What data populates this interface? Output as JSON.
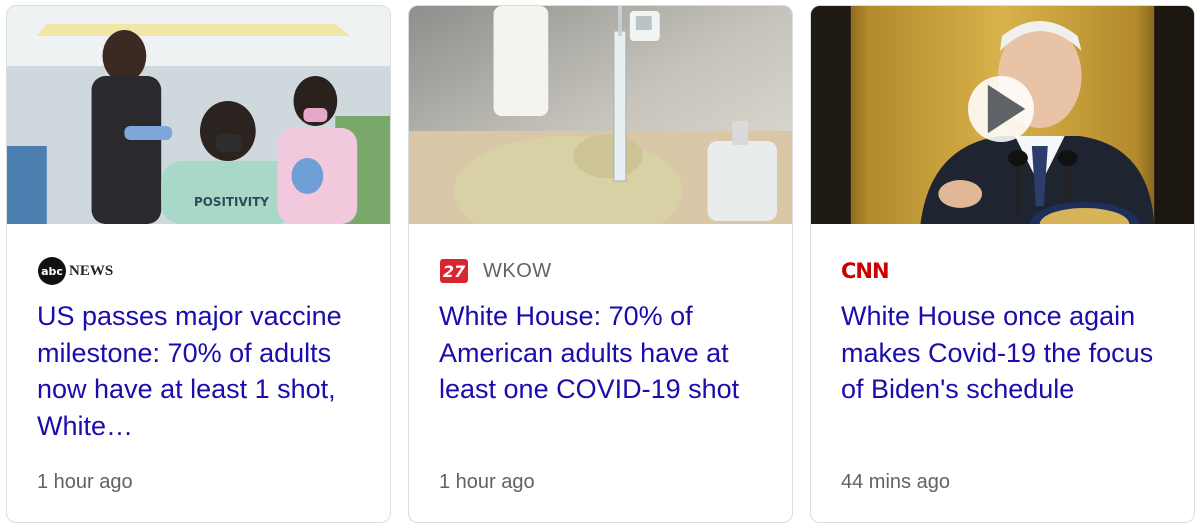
{
  "cards": [
    {
      "source": "NEWS",
      "headline": "US passes major vaccine milestone: 70% of adults now have at least 1 shot, White…",
      "time": "1 hour ago",
      "image_icon": "vaccination-photo"
    },
    {
      "source_logo_text": "27",
      "source": "WKOW",
      "headline": "White House: 70% of American adults have at least one COVID-19 shot",
      "time": "1 hour ago",
      "image_icon": "syringe-photo"
    },
    {
      "source": "CNN",
      "headline": "White House once again makes Covid-19 the focus of Biden's schedule",
      "time": "44 mins ago",
      "image_icon": "press-briefing-photo",
      "has_video": true
    }
  ],
  "colors": {
    "headline": "#1a0dab",
    "meta": "#5f6368",
    "border": "#dadce0",
    "cnn_red": "#cc0000",
    "wkow_red": "#d7262e"
  }
}
